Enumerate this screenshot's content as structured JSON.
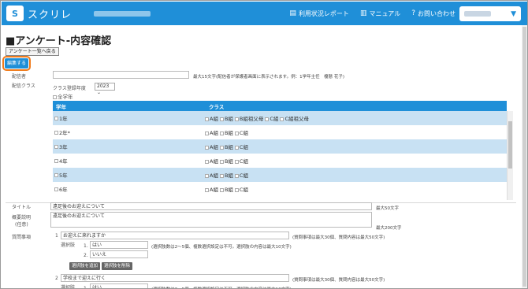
{
  "app": {
    "logo_mark": "S",
    "name": "スクリレ"
  },
  "nav": {
    "progress_report": "利用状況レポート",
    "manual": "マニュアル",
    "contact": "お問い合わせ"
  },
  "page": {
    "title": "■アンケート-内容確認",
    "back_label": "アンケート一覧へ戻る",
    "edit_label": "編集する"
  },
  "sender": {
    "label": "配信者",
    "hint": "最大15文字(配信者が保護者画面に表示されます。例：1学年主任　榎懸 花子)"
  },
  "distribution_class": {
    "label": "配信クラス",
    "year_label": "クラス登録年度",
    "year_value": "2023",
    "all_grades_label": "全学年",
    "header_grade": "学年",
    "header_class": "クラス",
    "rows": [
      {
        "grade": "1年",
        "classes": [
          "A組",
          "B組",
          "B組祖父母",
          "C組",
          "C組祖父母"
        ]
      },
      {
        "grade": "2年*",
        "classes": [
          "A組",
          "B組",
          "C組"
        ]
      },
      {
        "grade": "3年",
        "classes": [
          "A組",
          "B組",
          "C組"
        ]
      },
      {
        "grade": "4年",
        "classes": [
          "A組",
          "B組",
          "C組"
        ]
      },
      {
        "grade": "5年",
        "classes": [
          "A組",
          "B組",
          "C組"
        ]
      },
      {
        "grade": "6年",
        "classes": [
          "A組",
          "B組",
          "C組"
        ]
      }
    ]
  },
  "title_field": {
    "label": "タイトル",
    "value": "遠足後のお迎えについて",
    "hint": "最大50文字"
  },
  "summary_field": {
    "label": "概要説明",
    "label2": "(任意)",
    "value": "遠足後のお迎えについて",
    "hint": "最大200文字"
  },
  "questions": {
    "label": "質問事項",
    "choices_label": "選択肢",
    "limit_hint": "(質問事項は最大30個、質問内容は最大50文字)",
    "choice_hint": "(選択肢数は2〜5個、複数選択設定は不可。選択肢の内容は最大10文字)",
    "add_choice": "選択肢を追加",
    "delete_choice": "選択肢を削除",
    "items": [
      {
        "num": "1",
        "text": "お迎えに来れますか",
        "choices": [
          {
            "num": "1.",
            "text": "はい"
          },
          {
            "num": "2.",
            "text": "いいえ"
          }
        ]
      },
      {
        "num": "2",
        "text": "学校まで迎えに行く",
        "choices": [
          {
            "num": "1.",
            "text": "はい"
          }
        ]
      }
    ]
  },
  "colors": {
    "accent": "#1f8fd8",
    "highlight": "#f07a1a",
    "row_alt": "#c8e1f3"
  }
}
